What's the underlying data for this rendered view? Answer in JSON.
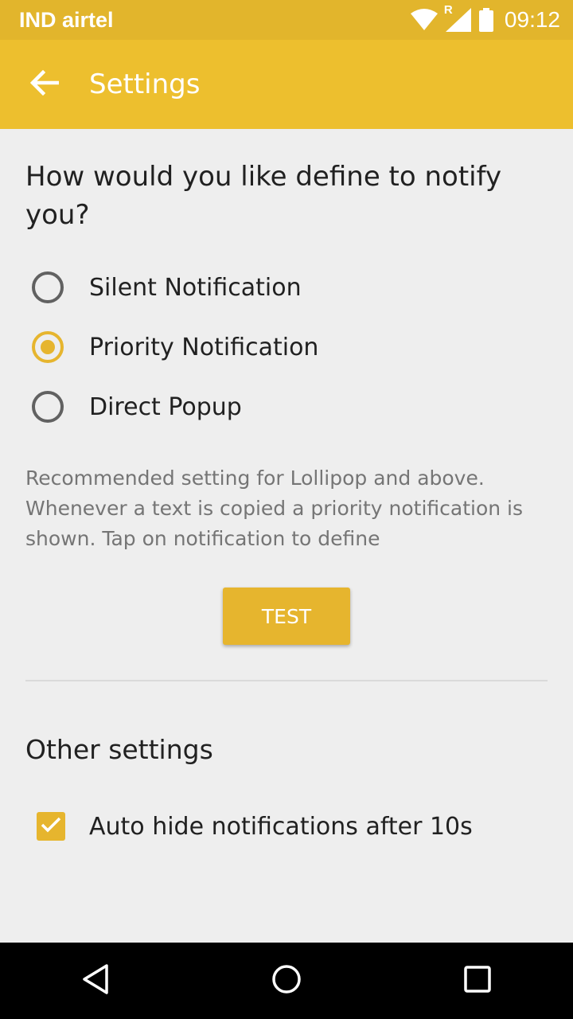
{
  "status_bar": {
    "carrier": "IND airtel",
    "time": "09:12",
    "roaming_indicator": "R",
    "icons": [
      "wifi-icon",
      "signal-icon",
      "battery-icon"
    ]
  },
  "app_bar": {
    "title": "Settings",
    "back_icon": "arrow-back-icon"
  },
  "notify_section": {
    "question": "How would you like define to notify you?",
    "options": [
      {
        "label": "Silent Notification",
        "selected": false
      },
      {
        "label": "Priority Notification",
        "selected": true
      },
      {
        "label": "Direct Popup",
        "selected": false
      }
    ],
    "hint": "Recommended setting for Lollipop and above. Whenever a text is copied a priority notification is shown. Tap on notification to define",
    "test_button": "TEST"
  },
  "other_settings": {
    "title": "Other settings",
    "auto_hide": {
      "label": "Auto hide notifications after 10s",
      "checked": true
    }
  },
  "nav_bar": {
    "icons": [
      "back-triangle-icon",
      "home-circle-icon",
      "recents-square-icon"
    ]
  },
  "colors": {
    "status_bar": "#e2b52c",
    "app_bar": "#edbf2e",
    "accent": "#e6b52e",
    "background": "#eeeeee"
  }
}
